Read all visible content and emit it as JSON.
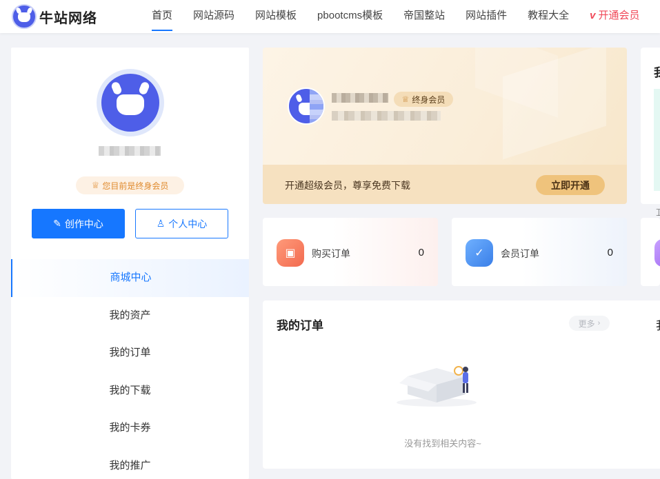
{
  "header": {
    "logo_text": "牛站网络",
    "nav": [
      {
        "label": "首页",
        "active": true
      },
      {
        "label": "网站源码"
      },
      {
        "label": "网站模板"
      },
      {
        "label": "pbootcms模板"
      },
      {
        "label": "帝国整站"
      },
      {
        "label": "网站插件"
      },
      {
        "label": "教程大全"
      }
    ],
    "vip_mark": "v",
    "vip_label": "开通会员"
  },
  "profile": {
    "member_status": "您目前是终身会员",
    "create_center_label": "创作中心",
    "personal_center_label": "个人中心"
  },
  "menu": {
    "items": [
      {
        "label": "商城中心",
        "active": true
      },
      {
        "label": "我的资产"
      },
      {
        "label": "我的订单"
      },
      {
        "label": "我的下载"
      },
      {
        "label": "我的卡券"
      },
      {
        "label": "我的推广"
      }
    ]
  },
  "vip_card": {
    "badge_label": "终身会员",
    "promo_text": "开通超级会员，尊享免费下载",
    "cta_label": "立即开通"
  },
  "right_panel": {
    "title_cut": "我"
  },
  "stats": [
    {
      "label": "购买订单",
      "value": "0",
      "icon": "gift-icon"
    },
    {
      "label": "会员订单",
      "value": "0",
      "icon": "check-list-icon"
    }
  ],
  "orders": {
    "title": "我的订单",
    "more_label": "更多",
    "cut_text": "我",
    "empty_text": "没有找到相关内容~"
  },
  "colors": {
    "primary": "#1677ff",
    "vip_red": "#f04858",
    "gold": "#efc37c",
    "brand": "#4e5ee8"
  }
}
